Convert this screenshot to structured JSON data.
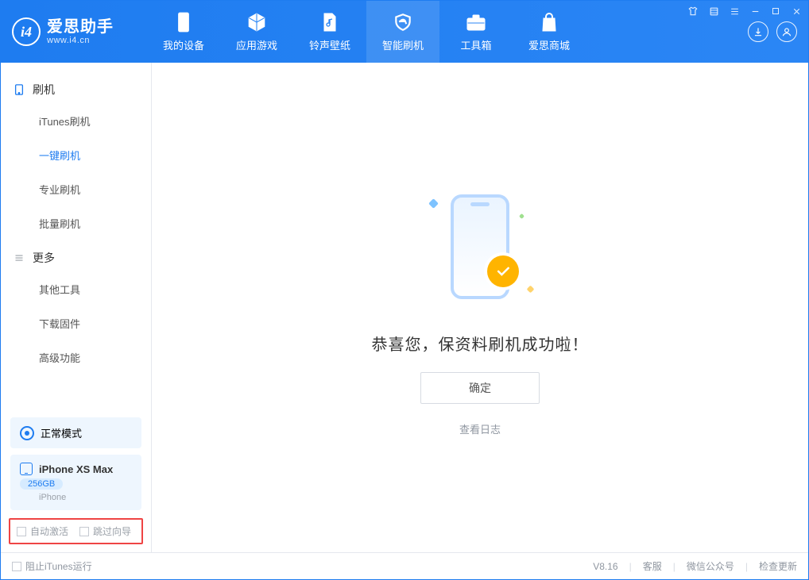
{
  "logo": {
    "title": "爱思助手",
    "subtitle": "www.i4.cn"
  },
  "tabs": [
    {
      "id": "device",
      "label": "我的设备"
    },
    {
      "id": "apps",
      "label": "应用游戏"
    },
    {
      "id": "ring",
      "label": "铃声壁纸"
    },
    {
      "id": "flash",
      "label": "智能刷机"
    },
    {
      "id": "toolbox",
      "label": "工具箱"
    },
    {
      "id": "store",
      "label": "爱思商城"
    }
  ],
  "sidebar": {
    "sections": [
      {
        "key": "flash",
        "title": "刷机",
        "items": [
          {
            "key": "itunes",
            "label": "iTunes刷机"
          },
          {
            "key": "onekey",
            "label": "一键刷机"
          },
          {
            "key": "pro",
            "label": "专业刷机"
          },
          {
            "key": "batch",
            "label": "批量刷机"
          }
        ]
      },
      {
        "key": "more",
        "title": "更多",
        "items": [
          {
            "key": "other",
            "label": "其他工具"
          },
          {
            "key": "firmware",
            "label": "下载固件"
          },
          {
            "key": "advanced",
            "label": "高级功能"
          }
        ]
      }
    ],
    "mode_label": "正常模式",
    "device": {
      "name": "iPhone XS Max",
      "capacity": "256GB",
      "platform": "iPhone"
    },
    "opts": {
      "auto_activate": "自动激活",
      "skip_guide": "跳过向导"
    }
  },
  "main": {
    "success_msg": "恭喜您，保资料刷机成功啦！",
    "ok_label": "确定",
    "log_link": "查看日志"
  },
  "footer": {
    "block_itunes": "阻止iTunes运行",
    "version": "V8.16",
    "links": {
      "service": "客服",
      "wechat": "微信公众号",
      "update": "检查更新"
    }
  }
}
